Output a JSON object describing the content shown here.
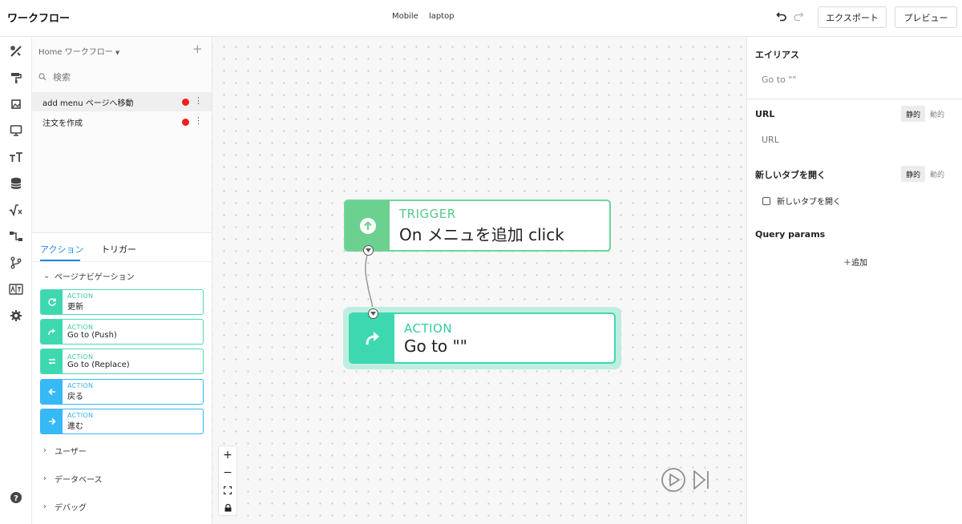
{
  "app": {
    "title": "ワークフロー",
    "device_tabs": [
      "Mobile",
      "laptop"
    ],
    "export_label": "エクスポート",
    "preview_label": "プレビュー"
  },
  "rail": {
    "icons": [
      "tools-icon",
      "paint-roller-icon",
      "frame-icon",
      "monitor-icon",
      "typography-icon",
      "database-icon",
      "formula-icon",
      "workflow-icon",
      "git-branch-icon",
      "translate-icon",
      "settings-icon",
      "help-icon"
    ]
  },
  "workflows": {
    "header": "Home ワークフロー",
    "search_placeholder": "検索",
    "items": [
      {
        "label": "add menu ページへ移動",
        "status_color": "#f01e1e"
      },
      {
        "label": "注文を作成",
        "status_color": "#f01e1e"
      }
    ]
  },
  "library": {
    "tabs": [
      "アクション",
      "トリガー"
    ],
    "categories": {
      "page_nav": "ページナビゲーション",
      "user": "ユーザー",
      "database": "データベース",
      "debug": "デバッグ"
    },
    "actions": [
      {
        "kind": "ACTION",
        "label": "更新",
        "icon": "refresh-icon",
        "color": "#3ed8b0"
      },
      {
        "kind": "ACTION",
        "label": "Go to (Push)",
        "icon": "forward-arrow-icon",
        "color": "#3ed8b0"
      },
      {
        "kind": "ACTION",
        "label": "Go to (Replace)",
        "icon": "replace-icon",
        "color": "#3ed8b0"
      },
      {
        "kind": "ACTION",
        "label": "戻る",
        "icon": "arrow-left-icon",
        "color": "#37b8f7"
      },
      {
        "kind": "ACTION",
        "label": "進む",
        "icon": "arrow-right-icon",
        "color": "#37b8f7"
      }
    ]
  },
  "canvas": {
    "trigger": {
      "kind": "TRIGGER",
      "label": "On メニュを追加 click",
      "color": "#6cd18f"
    },
    "action": {
      "kind": "ACTION",
      "label": "Go to \"\"",
      "color": "#3ed8b0"
    },
    "zoom_controls": [
      "+",
      "−"
    ]
  },
  "properties": {
    "alias_label": "エイリアス",
    "alias_value": "Go to \"\"",
    "url_label": "URL",
    "url_placeholder": "URL",
    "new_tab_label": "新しいタブを開く",
    "new_tab_checkbox": "新しいタブを開く",
    "mode_static": "静的",
    "mode_dynamic": "動的",
    "query_label": "Query params",
    "add_label": "＋追加"
  }
}
